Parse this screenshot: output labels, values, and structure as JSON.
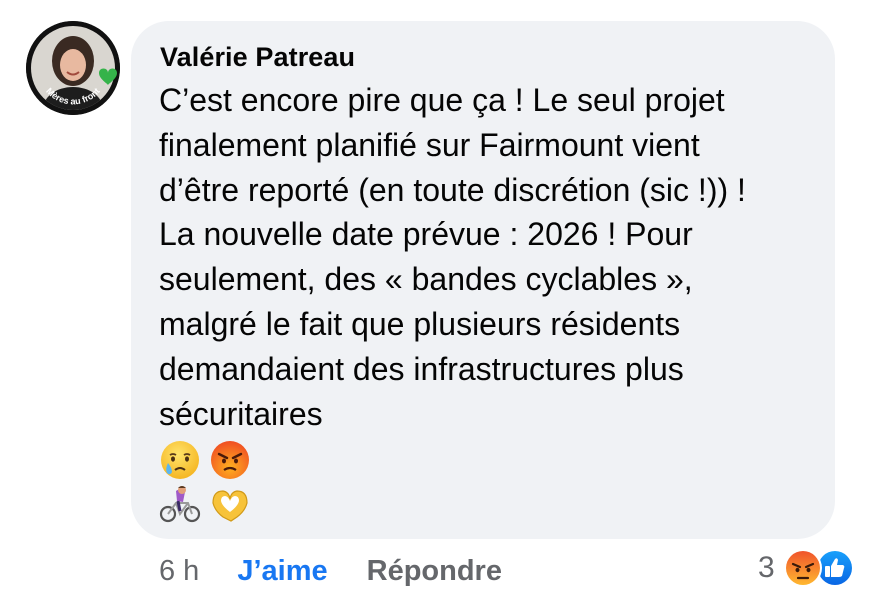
{
  "comment": {
    "author": "Valérie Patreau",
    "avatar_badge_text": "Mères au front",
    "text_lines": [
      "C’est encore pire que ça ! Le seul projet",
      "finalement planifié sur Fairmount vient",
      "d’être reporté (en toute discrétion (sic !)) !",
      "La nouvelle date prévue : 2026 ! Pour",
      "seulement, des « bandes cyclables »,",
      "malgré le fait que plusieurs résidents",
      "demandaient des infrastructures plus",
      "sécuritaires"
    ],
    "emoji_rows": [
      [
        "crying-face-icon",
        "angry-face-icon"
      ],
      [
        "woman-biking-icon",
        "heart-hands-icon"
      ]
    ]
  },
  "actions": {
    "time": "6 h",
    "like_label": "J’aime",
    "reply_label": "Répondre"
  },
  "reactions": {
    "count": "3",
    "icons": [
      "angry-reaction-icon",
      "like-reaction-icon"
    ]
  },
  "colors": {
    "bubble_bg": "#f0f2f5",
    "text": "#050505",
    "secondary_text": "#65676b",
    "link_blue": "#1877f2",
    "badge_green": "#35b34a"
  }
}
